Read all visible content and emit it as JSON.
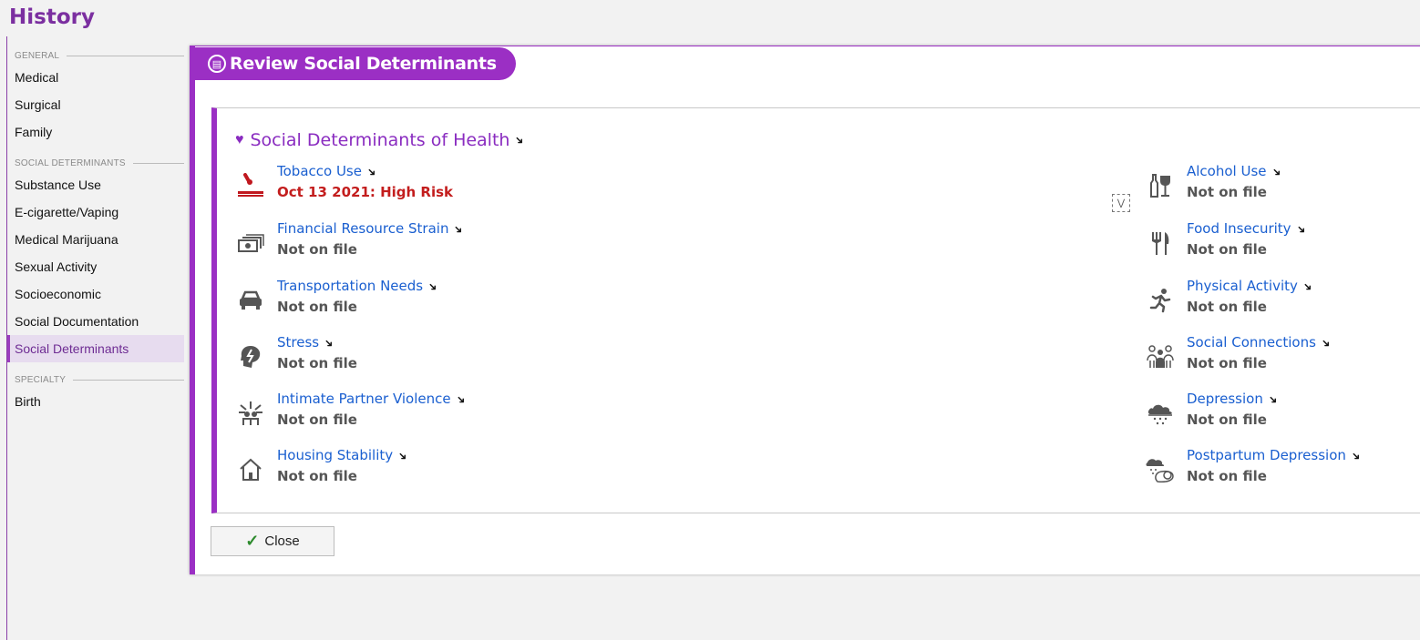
{
  "page": {
    "title": "History"
  },
  "nav": {
    "sections": [
      {
        "label": "General",
        "items": [
          "Medical",
          "Surgical",
          "Family"
        ]
      },
      {
        "label": "Social Determinants",
        "items": [
          "Substance Use",
          "E-cigarette/Vaping",
          "Medical Marijuana",
          "Sexual Activity",
          "Socioeconomic",
          "Social Documentation",
          "Social Determinants"
        ]
      },
      {
        "label": "Specialty",
        "items": [
          "Birth"
        ]
      }
    ],
    "active": "Social Determinants"
  },
  "dialog": {
    "title": "Review Social Determinants",
    "panel_title": "Social Determinants of Health",
    "close_label": "Close",
    "accent_color": "#9b2fc4",
    "left_items": [
      {
        "label": "Tobacco Use",
        "value": "Oct 13 2021: High Risk",
        "icon": "cigarette-icon",
        "risk": true
      },
      {
        "label": "Financial Resource Strain",
        "value": "Not on file",
        "icon": "money-icon"
      },
      {
        "label": "Transportation Needs",
        "value": "Not on file",
        "icon": "car-icon"
      },
      {
        "label": "Stress",
        "value": "Not on file",
        "icon": "stress-head-icon"
      },
      {
        "label": "Intimate Partner Violence",
        "value": "Not on file",
        "icon": "violence-icon"
      },
      {
        "label": "Housing Stability",
        "value": "Not on file",
        "icon": "house-icon"
      }
    ],
    "right_items": [
      {
        "label": "Alcohol Use",
        "value": "Not on file",
        "icon": "bottle-glass-icon"
      },
      {
        "label": "Food Insecurity",
        "value": "Not on file",
        "icon": "fork-knife-icon"
      },
      {
        "label": "Physical Activity",
        "value": "Not on file",
        "icon": "running-person-icon"
      },
      {
        "label": "Social Connections",
        "value": "Not on file",
        "icon": "people-group-icon"
      },
      {
        "label": "Depression",
        "value": "Not on file",
        "icon": "rain-cloud-icon"
      },
      {
        "label": "Postpartum Depression",
        "value": "Not on file",
        "icon": "cloud-baby-icon"
      }
    ]
  }
}
